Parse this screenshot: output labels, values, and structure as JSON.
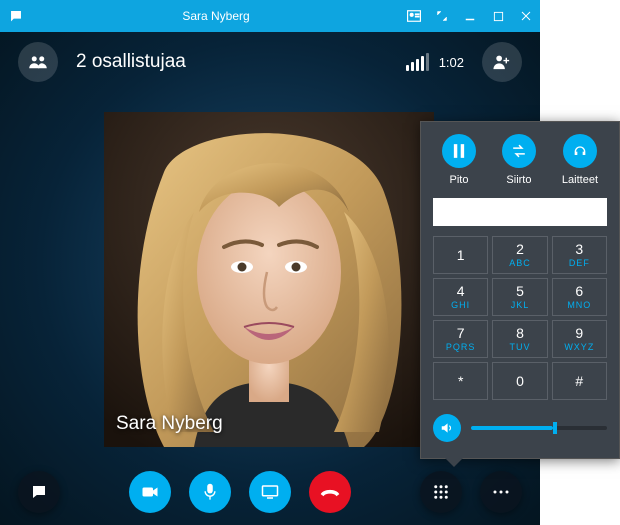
{
  "titlebar": {
    "title": "Sara Nyberg"
  },
  "topbar": {
    "participants_label": "2 osallistujaa",
    "duration": "1:02"
  },
  "video": {
    "caller_name": "Sara Nyberg"
  },
  "dialpad": {
    "actions": {
      "hold": "Pito",
      "transfer": "Siirto",
      "devices": "Laitteet"
    },
    "input_value": "",
    "keys": [
      {
        "num": "1",
        "ltr": ""
      },
      {
        "num": "2",
        "ltr": "ABC"
      },
      {
        "num": "3",
        "ltr": "DEF"
      },
      {
        "num": "4",
        "ltr": "GHI"
      },
      {
        "num": "5",
        "ltr": "JKL"
      },
      {
        "num": "6",
        "ltr": "MNO"
      },
      {
        "num": "7",
        "ltr": "PQRS"
      },
      {
        "num": "8",
        "ltr": "TUV"
      },
      {
        "num": "9",
        "ltr": "WXYZ"
      },
      {
        "num": "*",
        "ltr": ""
      },
      {
        "num": "0",
        "ltr": ""
      },
      {
        "num": "#",
        "ltr": ""
      }
    ],
    "volume_percent": 60
  },
  "colors": {
    "accent": "#00aff0",
    "danger": "#e81123",
    "panel": "#3c434b"
  }
}
